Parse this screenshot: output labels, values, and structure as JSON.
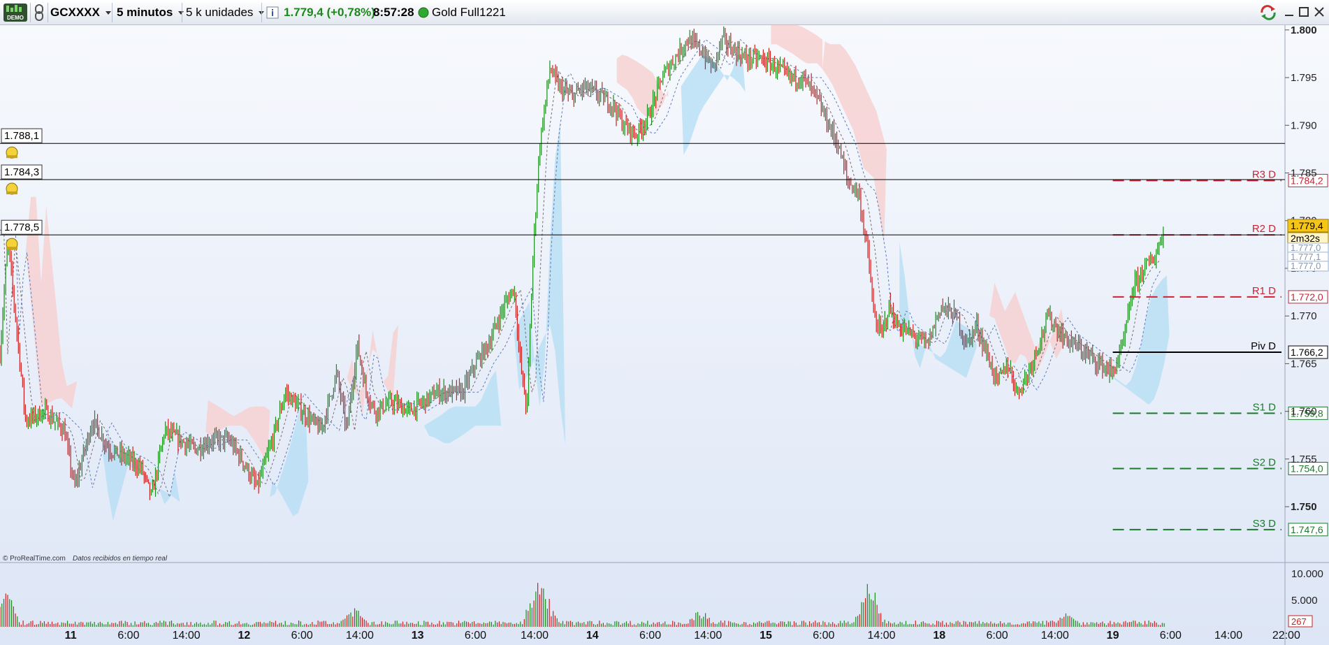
{
  "toolbar": {
    "demo_badge": "DEMO",
    "symbol": "GCXXXX",
    "timeframe": "5 minutos",
    "units": "5 k unidades",
    "last_price": "1.779,4",
    "change": "(+0,78%)",
    "time": "8:57:28",
    "instrument_name": "Gold Full1221",
    "icons": [
      "chart-settings-icon",
      "link-icon",
      "info-icon",
      "status-dot-icon",
      "sync-icon",
      "minimize-icon",
      "maximize-icon",
      "close-icon"
    ]
  },
  "colors": {
    "up": "#1a8a1a",
    "down": "#cc1f1f",
    "resistance": "#cc2233",
    "support": "#1a7a2a",
    "pivot": "#000000",
    "cloud_blue": "#b7def4",
    "cloud_red": "#f8d0d0",
    "background_top": "#f7f9fd",
    "background_bottom": "#dde6f6"
  },
  "chart": {
    "copyright": "© ProRealTime.com",
    "realtime_note": "Datos recibidos en tiempo real",
    "alert_lines": [
      {
        "label": "1.788,1",
        "value": 1788.1
      },
      {
        "label": "1.784,3",
        "value": 1784.3
      },
      {
        "label": "1.778,5",
        "value": 1778.5
      }
    ],
    "pivot_levels": [
      {
        "name": "R3 D",
        "value": 1784.2,
        "label": "1.784,2",
        "kind": "resistance"
      },
      {
        "name": "R2 D",
        "value": 1778.5,
        "label": "1.778,5",
        "kind": "resistance"
      },
      {
        "name": "R1 D",
        "value": 1772.0,
        "label": "1.772,0",
        "kind": "resistance"
      },
      {
        "name": "Piv D",
        "value": 1766.2,
        "label": "1.766,2",
        "kind": "pivot"
      },
      {
        "name": "S1 D",
        "value": 1759.8,
        "label": "1.759,8",
        "kind": "support"
      },
      {
        "name": "S2 D",
        "value": 1754.0,
        "label": "1.754,0",
        "kind": "support"
      },
      {
        "name": "S3 D",
        "value": 1747.6,
        "label": "1.747,6",
        "kind": "support"
      }
    ],
    "current_price_tag": "1.779,4",
    "countdown": "2m32s",
    "extra_tags": [
      "1.777,0",
      "1.777,1",
      "1.777,0"
    ],
    "volume_last": "267"
  },
  "chart_data": {
    "type": "candlestick",
    "price_axis": {
      "ticks": [
        "1.800",
        "1.795",
        "1.790",
        "1.785",
        "1.780",
        "1.775",
        "1.770",
        "1.765",
        "1.760",
        "1.755",
        "1.750"
      ],
      "tick_values": [
        1800,
        1795,
        1790,
        1785,
        1780,
        1775,
        1770,
        1765,
        1760,
        1755,
        1750
      ],
      "bold_ticks": [
        "1.800",
        "1.750"
      ],
      "ylim": [
        1747.0,
        1800.5
      ]
    },
    "volume_axis": {
      "ticks": [
        "10.000",
        "5.000"
      ],
      "tick_values": [
        10000,
        5000
      ],
      "ylim": [
        0,
        12000
      ]
    },
    "time_axis": {
      "ticks": [
        {
          "label": "11",
          "bold": true,
          "t": 0.055
        },
        {
          "label": "6:00",
          "bold": false,
          "t": 0.1
        },
        {
          "label": "14:00",
          "bold": false,
          "t": 0.145
        },
        {
          "label": "12",
          "bold": true,
          "t": 0.19
        },
        {
          "label": "6:00",
          "bold": false,
          "t": 0.235
        },
        {
          "label": "14:00",
          "bold": false,
          "t": 0.28
        },
        {
          "label": "13",
          "bold": true,
          "t": 0.325
        },
        {
          "label": "6:00",
          "bold": false,
          "t": 0.37
        },
        {
          "label": "14:00",
          "bold": false,
          "t": 0.416
        },
        {
          "label": "14",
          "bold": true,
          "t": 0.461
        },
        {
          "label": "6:00",
          "bold": false,
          "t": 0.506
        },
        {
          "label": "14:00",
          "bold": false,
          "t": 0.551
        },
        {
          "label": "15",
          "bold": true,
          "t": 0.596
        },
        {
          "label": "6:00",
          "bold": false,
          "t": 0.641
        },
        {
          "label": "14:00",
          "bold": false,
          "t": 0.686
        },
        {
          "label": "18",
          "bold": true,
          "t": 0.731
        },
        {
          "label": "6:00",
          "bold": false,
          "t": 0.776
        },
        {
          "label": "14:00",
          "bold": false,
          "t": 0.821
        },
        {
          "label": "19",
          "bold": true,
          "t": 0.866
        },
        {
          "label": "6:00",
          "bold": false,
          "t": 0.911
        },
        {
          "label": "14:00",
          "bold": false,
          "t": 0.956
        },
        {
          "label": "22:00",
          "bold": false,
          "t": 1.001
        }
      ]
    },
    "price_path": [
      [
        0.0,
        1766
      ],
      [
        0.006,
        1778
      ],
      [
        0.012,
        1770
      ],
      [
        0.02,
        1759
      ],
      [
        0.035,
        1760
      ],
      [
        0.05,
        1758
      ],
      [
        0.058,
        1752
      ],
      [
        0.072,
        1759
      ],
      [
        0.085,
        1756
      ],
      [
        0.1,
        1755
      ],
      [
        0.11,
        1754
      ],
      [
        0.118,
        1751
      ],
      [
        0.128,
        1758
      ],
      [
        0.14,
        1757
      ],
      [
        0.152,
        1756
      ],
      [
        0.165,
        1757
      ],
      [
        0.178,
        1757
      ],
      [
        0.188,
        1755
      ],
      [
        0.2,
        1752
      ],
      [
        0.212,
        1757
      ],
      [
        0.222,
        1762
      ],
      [
        0.235,
        1760
      ],
      [
        0.25,
        1758
      ],
      [
        0.262,
        1764
      ],
      [
        0.27,
        1758
      ],
      [
        0.278,
        1767
      ],
      [
        0.285,
        1762
      ],
      [
        0.292,
        1760
      ],
      [
        0.305,
        1761
      ],
      [
        0.318,
        1760
      ],
      [
        0.33,
        1761
      ],
      [
        0.34,
        1762
      ],
      [
        0.35,
        1762
      ],
      [
        0.36,
        1762
      ],
      [
        0.37,
        1765
      ],
      [
        0.38,
        1767
      ],
      [
        0.392,
        1771
      ],
      [
        0.4,
        1773
      ],
      [
        0.405,
        1765
      ],
      [
        0.41,
        1760
      ],
      [
        0.415,
        1777
      ],
      [
        0.42,
        1788
      ],
      [
        0.428,
        1796
      ],
      [
        0.435,
        1794
      ],
      [
        0.445,
        1793
      ],
      [
        0.455,
        1794
      ],
      [
        0.468,
        1793
      ],
      [
        0.478,
        1792
      ],
      [
        0.485,
        1790
      ],
      [
        0.495,
        1789
      ],
      [
        0.505,
        1791
      ],
      [
        0.515,
        1795
      ],
      [
        0.525,
        1797
      ],
      [
        0.535,
        1799
      ],
      [
        0.545,
        1798
      ],
      [
        0.555,
        1796
      ],
      [
        0.562,
        1799
      ],
      [
        0.57,
        1798
      ],
      [
        0.58,
        1797
      ],
      [
        0.592,
        1797
      ],
      [
        0.605,
        1796
      ],
      [
        0.615,
        1795
      ],
      [
        0.625,
        1795
      ],
      [
        0.635,
        1793
      ],
      [
        0.645,
        1790
      ],
      [
        0.652,
        1788
      ],
      [
        0.66,
        1784
      ],
      [
        0.668,
        1783
      ],
      [
        0.676,
        1776
      ],
      [
        0.68,
        1770
      ],
      [
        0.686,
        1768
      ],
      [
        0.692,
        1771
      ],
      [
        0.698,
        1769
      ],
      [
        0.71,
        1768
      ],
      [
        0.722,
        1767
      ],
      [
        0.732,
        1771
      ],
      [
        0.744,
        1770
      ],
      [
        0.752,
        1767
      ],
      [
        0.76,
        1769
      ],
      [
        0.768,
        1766
      ],
      [
        0.776,
        1763
      ],
      [
        0.784,
        1765
      ],
      [
        0.792,
        1762
      ],
      [
        0.8,
        1764
      ],
      [
        0.808,
        1767
      ],
      [
        0.816,
        1770
      ],
      [
        0.826,
        1768
      ],
      [
        0.836,
        1767
      ],
      [
        0.846,
        1766
      ],
      [
        0.856,
        1765
      ],
      [
        0.866,
        1764
      ],
      [
        0.874,
        1767
      ],
      [
        0.882,
        1773
      ],
      [
        0.89,
        1775
      ],
      [
        0.898,
        1776
      ],
      [
        0.906,
        1779
      ]
    ],
    "volume_spikes": [
      [
        0.005,
        9000
      ],
      [
        0.275,
        3500
      ],
      [
        0.417,
        10500
      ],
      [
        0.425,
        6000
      ],
      [
        0.545,
        2500
      ],
      [
        0.674,
        6500
      ],
      [
        0.68,
        4000
      ],
      [
        0.83,
        2500
      ]
    ]
  }
}
